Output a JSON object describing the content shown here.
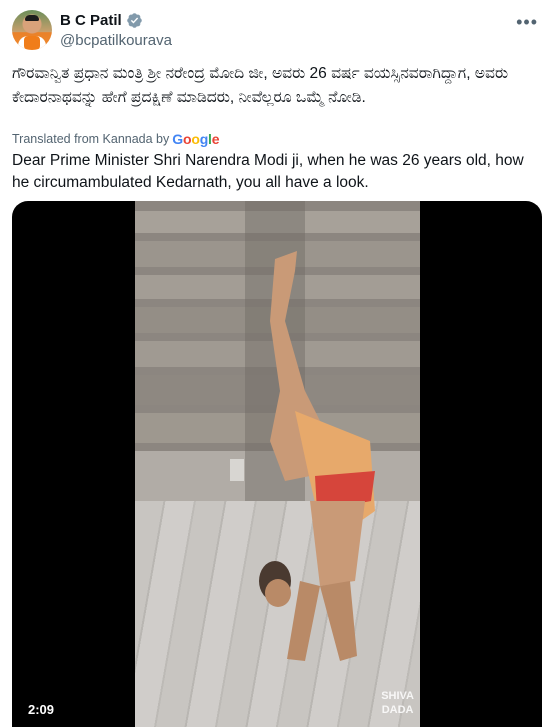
{
  "author": {
    "display_name": "B C Patil",
    "handle": "@bcpatilkourava",
    "verified_color": "#829aab"
  },
  "post": {
    "original_text": "ಗೌರವಾನ್ವಿತ ಪ್ರಧಾನ ಮಂತ್ರಿ ಶ್ರೀ ನರೇಂದ್ರ ಮೋದಿ ಜೀ, ಅವರು 26 ವರ್ಷ ವಯಸ್ಸಿನವರಾಗಿದ್ದಾಗ, ಅವರು ಕೇದಾರನಾಥವನ್ನು ಹೇಗೆ ಪ್ರದಕ್ಷಿಣೆ ಮಾಡಿದರು, ನೀವೆಲ್ಲರೂ ಒಮ್ಮೆ ನೋಡಿ.",
    "translated_label": "Translated from Kannada by",
    "translator_brand": [
      "G",
      "o",
      "o",
      "g",
      "l",
      "e"
    ],
    "translated_text": "Dear Prime Minister Shri Narendra Modi ji, when he was 26 years old, how he circumambulated Kedarnath, you all have a look."
  },
  "video": {
    "duration": "2:09",
    "watermark_line1": "SHIVA",
    "watermark_line2": "DADA"
  },
  "icons": {
    "more": "more-icon",
    "verified": "verified-badge-icon"
  }
}
